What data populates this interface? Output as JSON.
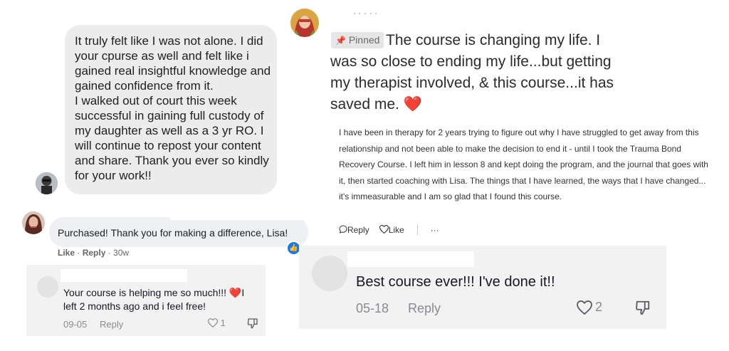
{
  "card1": {
    "text": "It truly felt like I was not alone. I did your cpurse as well and felt like i gained real insightful knowledge and gained confidence from it.\nI walked out of court this week successful in gaining full custody of my daughter as well as a 3 yr RO. I will continue to repost your content and share. Thank you ever so kindly for your work!!"
  },
  "card2": {
    "text": "Purchased! Thank you for making a difference, Lisa!",
    "like_label": "Like",
    "reply_label": "Reply",
    "separator": " · ",
    "time": "30w"
  },
  "card3": {
    "text": "Your course is helping me so much!!! ❤️I left 2 months ago and i feel free!",
    "date": "09-05",
    "reply_label": "Reply",
    "like_count": "1"
  },
  "pinned": {
    "badge": "Pinned",
    "title": "The course is changing my life. I was so close to ending my life...but getting my therapist involved, & this course...it has saved me.",
    "heart": "❤️",
    "body": "I have been in therapy for 2 years trying to figure out why I have struggled to get away from this relationship and not been able to make the decision to end it - until I took the Trauma Bond Recovery Course. I left him in lesson 8 and kept doing the program, and the journal that goes with it, then started coaching with Lisa. The things that I have learned, the ways that I have changed... it's immeasurable and I am so glad that I found this course.",
    "reply_label": "Reply",
    "like_label": "Like",
    "more_label": "···"
  },
  "card5": {
    "text": "Best course ever!!! I've done it!!",
    "date": "05-18",
    "reply_label": "Reply",
    "like_count": "2"
  }
}
